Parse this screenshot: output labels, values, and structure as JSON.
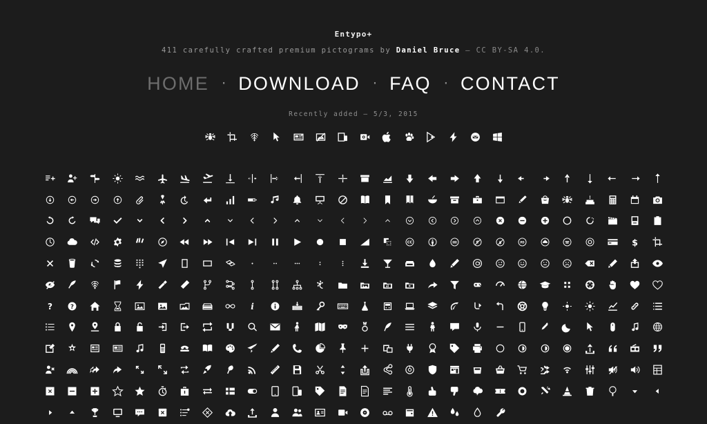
{
  "header": {
    "brand": "Entypo+",
    "tagline_prefix": "411 carefully crafted premium pictograms by ",
    "tagline_author": "Daniel Bruce",
    "tagline_suffix": " — CC BY-SA 4.0."
  },
  "nav": {
    "separator": "·",
    "items": [
      {
        "label": "HOME",
        "state": "muted"
      },
      {
        "label": "DOWNLOAD",
        "state": "active"
      },
      {
        "label": "FAQ",
        "state": "active"
      },
      {
        "label": "CONTACT",
        "state": "active"
      }
    ]
  },
  "recent": {
    "label": "Recently added — 5/3, 2015",
    "icons": [
      "bug-icon",
      "crop-icon",
      "fingerprint-icon",
      "cursor-icon",
      "news-card-icon",
      "image-off-icon",
      "mobile-device-icon",
      "video-camera-icon",
      "apple-logo-icon",
      "paw-icon",
      "google-play-icon",
      "flash-lightning-icon",
      "mail-circle-icon",
      "windows-logo-icon"
    ]
  },
  "grid": {
    "columns": 28,
    "icon_color": "#ffffff",
    "background": "#1c1c1c",
    "rows": [
      [
        "add-to-list-icon",
        "add-user-icon",
        "signpost-icon",
        "air-icon",
        "waves-icon",
        "airplane-icon",
        "airplane-landing-icon",
        "airplane-takeoff-icon",
        "align-bottom-icon",
        "align-horizontal-middle-icon",
        "align-left-icon",
        "align-right-icon",
        "align-top-icon",
        "align-vertical-middle-icon",
        "archive-icon",
        "area-graph-icon",
        "arrow-bold-down-icon",
        "arrow-bold-left-icon",
        "arrow-bold-right-icon",
        "arrow-bold-up-icon",
        "arrow-down-icon",
        "arrow-left-icon",
        "arrow-right-icon",
        "arrow-up-icon",
        "arrow-long-down-icon",
        "arrow-long-left-icon",
        "arrow-long-right-icon",
        "arrow-long-up-icon"
      ],
      [
        "circle-arrow-down-icon",
        "circle-arrow-left-icon",
        "circle-arrow-right-icon",
        "circle-arrow-up-icon",
        "attachment-icon",
        "awareness-ribbon-icon",
        "back-in-time-icon",
        "back-icon",
        "bar-graph-icon",
        "battery-icon",
        "beamed-note-icon",
        "bell-icon",
        "blackboard-icon",
        "block-icon",
        "book-icon",
        "bookmark-icon",
        "bookmarks-icon",
        "bowl-icon",
        "box-icon",
        "briefcase-icon",
        "browser-icon",
        "brush-icon",
        "bucket-icon",
        "bug-icon",
        "cake-icon",
        "calculator-icon",
        "calendar-icon",
        "camera-icon"
      ],
      [
        "ccw-icon",
        "cw-icon",
        "chat-icon",
        "check-icon",
        "chevron-down-icon",
        "chevron-left-icon",
        "chevron-right-icon",
        "chevron-up-icon",
        "chevron-small-down-icon",
        "chevron-small-left-icon",
        "chevron-small-right-icon",
        "chevron-small-up-icon",
        "chevron-thin-down-icon",
        "chevron-thin-left-icon",
        "chevron-thin-right-icon",
        "chevron-thin-up-icon",
        "chevron-with-circle-down-icon",
        "chevron-with-circle-left-icon",
        "chevron-with-circle-right-icon",
        "chevron-with-circle-up-icon",
        "circle-with-cross-icon",
        "circle-with-minus-icon",
        "circle-with-plus-icon",
        "circle-icon",
        "cycle-dotted-icon",
        "clapperboard-icon",
        "classic-computer-icon",
        "clipboard-icon"
      ],
      [
        "clock-icon",
        "cloud-icon",
        "code-icon",
        "cog-icon",
        "colours-icon",
        "compass-icon",
        "fast-backward-icon",
        "fast-forward-icon",
        "jump-to-start-icon",
        "next-icon",
        "pause-icon",
        "play-icon",
        "record-icon",
        "stop-icon",
        "volume-icon",
        "copy-icon",
        "creative-commons-icon",
        "cc-attribution-icon",
        "cc-noderivs-icon",
        "cc-noncommercial-eu-icon",
        "cc-noncommercial-us-icon",
        "cc-public-domain-icon",
        "cc-remix-icon",
        "cc-share-icon",
        "cc-sharealike-icon",
        "credit-card-icon",
        "credit-icon",
        "crop-icon"
      ],
      [
        "cross-icon",
        "cup-icon",
        "cycle-icon",
        "database-icon",
        "dial-pad-icon",
        "direction-icon",
        "document-icon",
        "documents-icon",
        "copy-documents-icon",
        "dot-single-icon",
        "dots-two-horizontal-icon",
        "dots-three-horizontal-icon",
        "dots-two-vertical-icon",
        "dots-three-vertical-icon",
        "download-icon",
        "drink-icon",
        "drive-icon",
        "drop-icon",
        "edit-icon",
        "email-icon",
        "emoji-flirt-icon",
        "emoji-happy-icon",
        "emoji-neutral-icon",
        "emoji-sad-icon",
        "erase-icon",
        "eraser-icon",
        "export-icon",
        "eye-icon"
      ],
      [
        "eye-with-line-icon",
        "feather-icon",
        "fingerprint-icon",
        "flag-icon",
        "flash-icon",
        "flashlight-icon",
        "flat-brush-icon",
        "flow-branch-icon",
        "flow-cascade-icon",
        "flow-line-icon",
        "flow-parallel-icon",
        "flow-tree-icon",
        "flower-icon",
        "folder-icon",
        "folder-images-icon",
        "folder-music-icon",
        "folder-video-icon",
        "forward-icon",
        "funnel-icon",
        "game-controller-icon",
        "gauge-icon",
        "globe-icon",
        "graduation-cap-icon",
        "grid-icon",
        "hair-cross-icon",
        "hand-icon",
        "heart-icon",
        "heart-outlined-icon"
      ],
      [
        "help-icon",
        "help-with-circle-icon",
        "home-icon",
        "hour-glass-icon",
        "image-icon",
        "image-inverted-icon",
        "images-icon",
        "inbox-icon",
        "infinity-icon",
        "info-icon",
        "info-with-circle-icon",
        "install-icon",
        "key-icon",
        "keyboard-icon",
        "lab-flask-icon",
        "landline-icon",
        "laptop-icon",
        "layers-icon",
        "leaf-icon",
        "level-down-icon",
        "level-up-icon",
        "lifebuoy-icon",
        "light-bulb-icon",
        "light-down-icon",
        "light-up-icon",
        "line-graph-icon",
        "link-icon",
        "list-icon"
      ],
      [
        "list-alt-icon",
        "location-pin-icon",
        "location-icon",
        "lock-icon",
        "lock-open-icon",
        "login-icon",
        "log-out-icon",
        "loop-icon",
        "magnet-icon",
        "magnifying-glass-icon",
        "mail-icon",
        "man-icon",
        "map-icon",
        "mask-icon",
        "medal-icon",
        "megaphone-icon",
        "menu-icon",
        "mens-icon",
        "message-icon",
        "mic-icon",
        "minus-icon",
        "mobile-icon",
        "modern-mic-icon",
        "moon-icon",
        "mouse-pointer-icon",
        "mouse-icon",
        "music-icon",
        "network-icon"
      ],
      [
        "new-message-icon",
        "new-icon",
        "news-icon",
        "newsletter-icon",
        "note-icon",
        "old-mobile-icon",
        "old-phone-icon",
        "open-book-icon",
        "palette-icon",
        "paper-plane-icon",
        "pencil-icon",
        "phone-icon",
        "pie-chart-icon",
        "pin-icon",
        "plus-icon",
        "popup-icon",
        "power-plug-icon",
        "price-ribbon-icon",
        "price-tag-icon",
        "print-icon",
        "progress-empty-icon",
        "progress-one-icon",
        "progress-two-icon",
        "progress-full-icon",
        "publish-icon",
        "quote-icon",
        "radio-icon",
        "quote-right-icon"
      ],
      [
        "remove-user-icon",
        "rainbow-icon",
        "reply-icon",
        "reply-all-icon",
        "resize-100-icon",
        "resize-full-icon",
        "retweet-icon",
        "rocket-icon",
        "round-brush-icon",
        "rss-icon",
        "ruler-icon",
        "save-icon",
        "scissors-icon",
        "select-arrows-icon",
        "share-alternative-icon",
        "share-icon",
        "shareable-icon",
        "shield-icon",
        "shop-icon",
        "shopping-bag-icon",
        "shopping-basket-icon",
        "shopping-cart-icon",
        "shuffle-icon",
        "signal-icon",
        "sound-mix-icon",
        "sound-mute-icon",
        "sound-icon",
        "spreadsheet-icon"
      ],
      [
        "squared-cross-icon",
        "squared-minus-icon",
        "squared-plus-icon",
        "star-outlined-icon",
        "star-icon",
        "stopwatch-icon",
        "suitcase-icon",
        "swap-icon",
        "sweden-icon",
        "switch-icon",
        "tablet-icon",
        "tablet-mobile-icon",
        "tag-icon",
        "text-document-inverted-icon",
        "text-document-icon",
        "text-icon",
        "thermometer-icon",
        "thumbs-down-icon",
        "thumbs-up-icon",
        "thunder-cloud-icon",
        "ticket-icon",
        "time-slot-icon",
        "tools-icon",
        "traffic-cone-icon",
        "trash-icon",
        "tree-icon",
        "triangle-down-icon",
        "triangle-left-icon"
      ],
      [
        "triangle-right-icon",
        "triangle-up-icon",
        "trophy-icon",
        "tv-icon",
        "typing-icon",
        "uninstall-icon",
        "unread-icon",
        "untag-icon",
        "upload-to-cloud-icon",
        "upload-icon",
        "user-icon",
        "users-icon",
        "v-card-icon",
        "video-icon",
        "vinyl-icon",
        "voicemail-icon",
        "wallet-icon",
        "warning-icon",
        "water-icon",
        "water-drop-icon",
        "wrench-icon"
      ]
    ]
  }
}
